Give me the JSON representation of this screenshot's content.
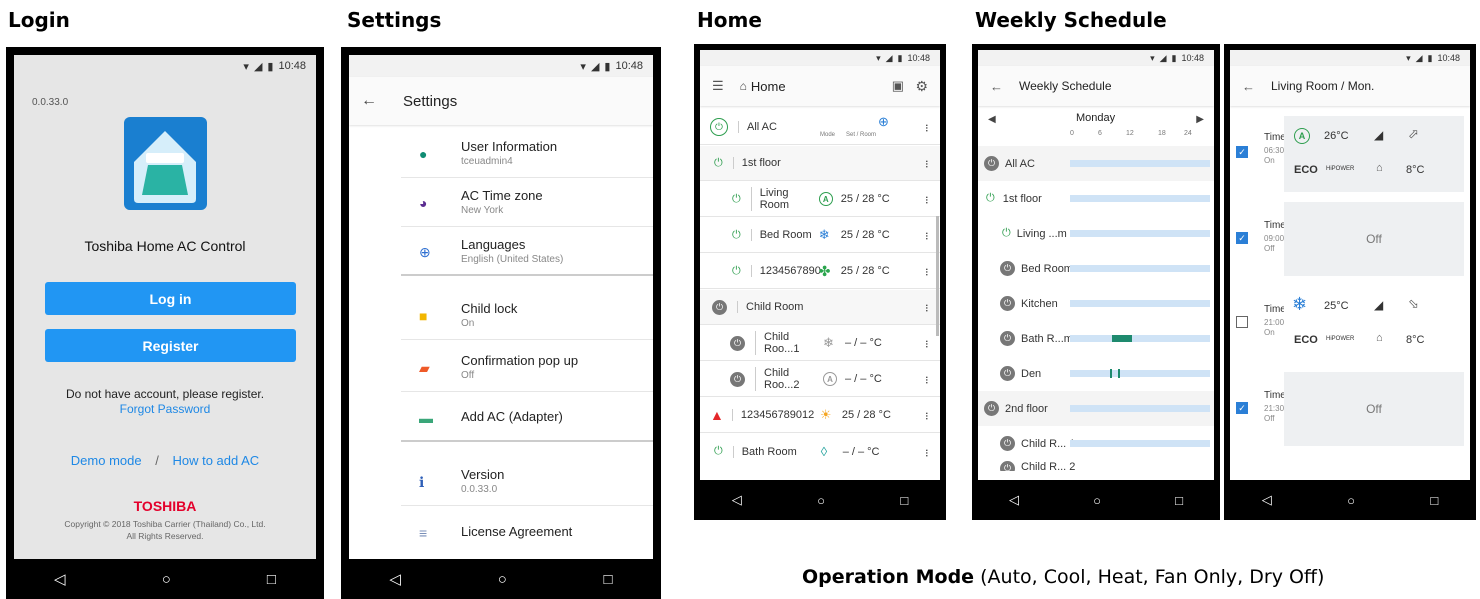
{
  "captions": {
    "login": "Login",
    "settings": "Settings",
    "home": "Home",
    "weekly": "Weekly Schedule"
  },
  "status_time": "10:48",
  "login": {
    "version": "0.0.33.0",
    "app_name": "Toshiba Home AC Control",
    "login_button": "Log in",
    "register_button": "Register",
    "no_account_text": "Do not have account, please register.",
    "forgot_password": "Forgot Password",
    "demo_mode": "Demo mode",
    "separator": "/",
    "how_to_add": "How to add AC",
    "brand": "TOSHIBA",
    "copyright1": "Copyright © 2018 Toshiba Carrier (Thailand) Co., Ltd.",
    "copyright2": "All Rights Reserved."
  },
  "settings": {
    "title": "Settings",
    "items": [
      {
        "title": "User Information",
        "sub": "tceuadmin4",
        "icon": "person-icon",
        "color": "#0f8c73"
      },
      {
        "title": "AC Time zone",
        "sub": "New York",
        "icon": "clock-icon",
        "color": "#5b2d91"
      },
      {
        "title": "Languages",
        "sub": "English (United States)",
        "icon": "globe-icon",
        "color": "#2e6fd1"
      },
      {
        "title": "Child lock",
        "sub": "On",
        "icon": "lock-icon",
        "color": "#f2b600"
      },
      {
        "title": "Confirmation pop up",
        "sub": "Off",
        "icon": "chat-icon",
        "color": "#ef5a28"
      },
      {
        "title": "Add AC (Adapter)",
        "sub": "",
        "icon": "ac-unit-icon",
        "color": "#3aa679"
      },
      {
        "title": "Version",
        "sub": "0.0.33.0",
        "icon": "info-icon",
        "color": "#2e5fb8"
      },
      {
        "title": "License Agreement",
        "sub": "",
        "icon": "document-icon",
        "color": "#7a8fb8"
      }
    ]
  },
  "home": {
    "title": "Home",
    "col_mode": "Mode",
    "col_set": "Set / Room",
    "rows": [
      {
        "name": "All AC",
        "mode": "",
        "temp": ""
      },
      {
        "name": "1st floor",
        "mode": "",
        "temp": ""
      },
      {
        "name": "Living Room",
        "mode": "A",
        "temp": "25 / 28 °C"
      },
      {
        "name": "Bed Room",
        "mode": "❄",
        "temp": "25 / 28 °C"
      },
      {
        "name": "1234567890",
        "mode": "✤",
        "temp": "25 / 28 °C"
      },
      {
        "name": "Child Room",
        "mode": "",
        "temp": ""
      },
      {
        "name": "Child Roo...1",
        "mode": "❄",
        "temp": "– / –  °C"
      },
      {
        "name": "Child Roo...2",
        "mode": "A",
        "temp": "– / –  °C"
      },
      {
        "name": "123456789012",
        "mode": "☀",
        "temp": "25 / 28 °C"
      },
      {
        "name": "Bath Room",
        "mode": "◊",
        "temp": "– / –  °C"
      }
    ]
  },
  "weekly": {
    "title": "Weekly Schedule",
    "day": "Monday",
    "ticks": [
      "0",
      "6",
      "12",
      "18",
      "24"
    ],
    "rows": [
      "All AC",
      "1st floor",
      "Living ...m",
      "Bed Room",
      "Kitchen",
      "Bath R...m",
      "Den",
      "2nd floor",
      "Child R... 1",
      "Child R... 2"
    ]
  },
  "day_schedule": {
    "title": "Living Room / Mon.",
    "times": [
      {
        "label": "Time 1",
        "time": "06:30",
        "state": "On",
        "checked": true,
        "temp": "26°C",
        "eco": "ECO",
        "hipower": "HiPOWER",
        "fan_temp": "8°C"
      },
      {
        "label": "Time 2",
        "time": "09:00",
        "state": "Off",
        "checked": true,
        "off_text": "Off"
      },
      {
        "label": "Time 3",
        "time": "21:00",
        "state": "On",
        "checked": false,
        "temp": "25°C",
        "eco": "ECO",
        "hipower": "HiPOWER",
        "fan_temp": "8°C"
      },
      {
        "label": "Time 4",
        "time": "21:30",
        "state": "Off",
        "checked": true,
        "off_text": "Off"
      }
    ]
  },
  "footer": {
    "bold": "Operation Mode",
    "rest": " (Auto, Cool, Heat, Fan Only, Dry Off)"
  }
}
